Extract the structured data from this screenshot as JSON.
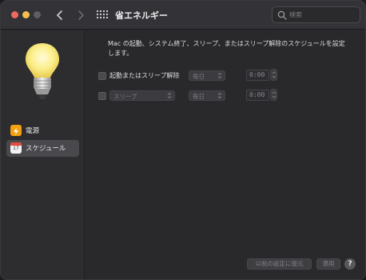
{
  "window": {
    "title": "省エネルギー"
  },
  "toolbar": {
    "icons": [
      "chevron-left-icon",
      "chevron-right-icon",
      "grid-icon"
    ],
    "search_placeholder": "検索"
  },
  "sidebar": {
    "items": [
      {
        "label": "電源",
        "icon": "lightning-bolt-icon",
        "selected": false
      },
      {
        "label": "スケジュール",
        "icon": "calendar-icon",
        "selected": true,
        "icon_text": "17"
      }
    ]
  },
  "main": {
    "description": "Mac の起動、システム終了、スリープ、またはスリープ解除のスケジュールを設定します。",
    "rows": [
      {
        "checkbox_checked": false,
        "label": "起動またはスリープ解除",
        "day_value": "毎日",
        "time_value": "0:00"
      },
      {
        "checkbox_checked": false,
        "action_value": "スリープ",
        "day_value": "毎日",
        "time_value": "0:00"
      }
    ],
    "buttons": {
      "restore": "以前の設定に復元",
      "apply": "適用",
      "help": "?"
    }
  },
  "colors": {
    "window_bg": "#29282b",
    "sidebar_bg": "#2d2c2f",
    "selected_item": "#49484c",
    "power_icon": "#f4a00f",
    "close": "#ed6a5e",
    "minimize": "#f5bf4f"
  }
}
